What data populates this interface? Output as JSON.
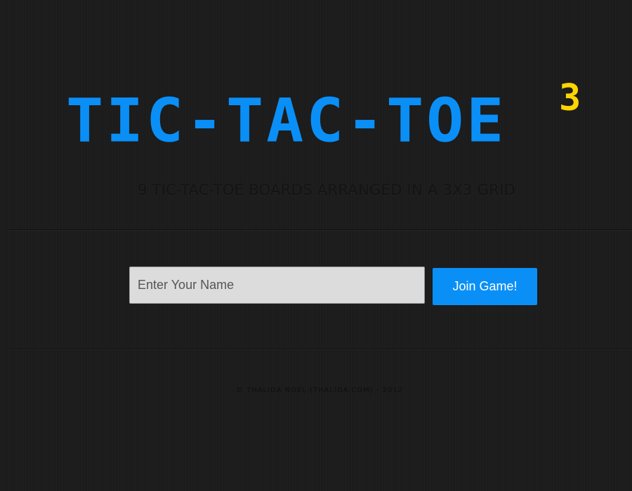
{
  "header": {
    "title": "TIC-TAC-TOE",
    "superscript": "3",
    "subtitle": "9 TIC-TAC-TOE BOARDS ARRANGED IN A 3X3 GRID"
  },
  "join_form": {
    "name_placeholder": "Enter Your Name",
    "name_value": "",
    "join_button_label": "Join Game!"
  },
  "footer": {
    "credit": "© THALIDA NOEL (THALIDA.COM) - 2012"
  },
  "colors": {
    "background": "#1c1c1c",
    "title": "#0a8ff7",
    "superscript": "#ffd500",
    "subtitle": "#141414",
    "button_bg": "#0a8ff7",
    "button_text": "#ffffff",
    "footer_text": "#0f0f0f"
  }
}
